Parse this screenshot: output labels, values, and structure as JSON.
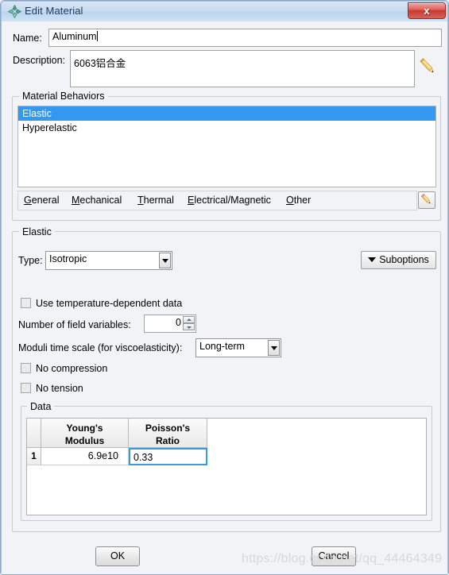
{
  "window": {
    "title": "Edit Material",
    "icon": "abaqus-diamond-icon",
    "close_label": "x"
  },
  "fields": {
    "name_label": "Name:",
    "name_value": "Aluminum",
    "description_label": "Description:",
    "description_value": "6063铝合金"
  },
  "material_behaviors": {
    "group_title": "Material Behaviors",
    "items": [
      {
        "label": "Elastic",
        "selected": true
      },
      {
        "label": "Hyperelastic",
        "selected": false
      }
    ],
    "menu": [
      {
        "mnemonic": "G",
        "rest": "eneral"
      },
      {
        "mnemonic": "M",
        "rest": "echanical"
      },
      {
        "mnemonic": "T",
        "rest": "hermal"
      },
      {
        "mnemonic": "E",
        "rest": "lectrical/Magnetic"
      },
      {
        "mnemonic": "O",
        "rest": "ther"
      }
    ]
  },
  "elastic": {
    "group_title": "Elastic",
    "type_label": "Type:",
    "type_value": "Isotropic",
    "suboptions_label": "Suboptions",
    "use_temp_label": "Use temperature-dependent data",
    "use_temp_checked": false,
    "field_vars_label": "Number of field variables:",
    "field_vars_value": "0",
    "moduli_label": "Moduli time scale (for viscoelasticity):",
    "moduli_value": "Long-term",
    "no_compression_label": "No compression",
    "no_compression_checked": false,
    "no_tension_label": "No tension",
    "no_tension_checked": false
  },
  "data_table": {
    "group_title": "Data",
    "columns": [
      {
        "line1": "Young's",
        "line2": "Modulus"
      },
      {
        "line1": "Poisson's",
        "line2": "Ratio"
      }
    ],
    "rows": [
      {
        "index": "1",
        "youngs_modulus": "6.9e10",
        "poissons_ratio": "0.33"
      }
    ]
  },
  "buttons": {
    "ok": "OK",
    "cancel": "Cancel"
  },
  "watermark": "https://blog.csdn.net/qq_44464349",
  "colors": {
    "selection_blue": "#3399f0",
    "focus_border": "#3b9adb",
    "title_blue": "#c7dbf0",
    "close_red": "#c93a32"
  }
}
